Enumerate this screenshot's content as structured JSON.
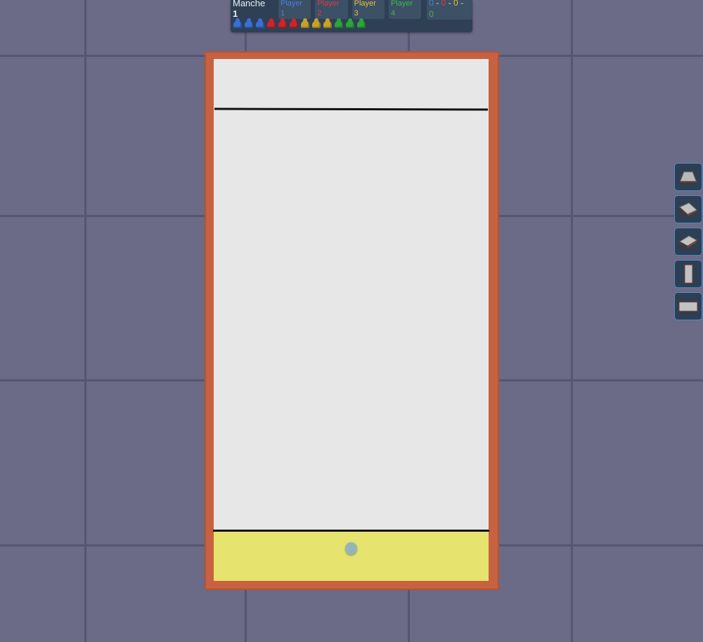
{
  "hud": {
    "round_label": "Manche",
    "round_number": "1",
    "players": [
      {
        "name": "Player 1",
        "color": "#4c7fe0"
      },
      {
        "name": "Player 2",
        "color": "#e0394b"
      },
      {
        "name": "Player 3",
        "color": "#e8c03a"
      },
      {
        "name": "Player 4",
        "color": "#3fb84a"
      }
    ],
    "scores": [
      "0",
      "0",
      "0",
      "0"
    ],
    "score_separator": "-",
    "pawns": [
      {
        "color": "#3a6fd8"
      },
      {
        "color": "#3a6fd8"
      },
      {
        "color": "#3a6fd8"
      },
      {
        "color": "#d0232c"
      },
      {
        "color": "#d0232c"
      },
      {
        "color": "#d0232c"
      },
      {
        "color": "#c9a12a"
      },
      {
        "color": "#c9a12a"
      },
      {
        "color": "#c9a12a"
      },
      {
        "color": "#2aa63a"
      },
      {
        "color": "#2aa63a"
      },
      {
        "color": "#2aa63a"
      }
    ]
  },
  "board": {
    "frame_color": "#c7613f",
    "field_color": "#e7e7e7",
    "home_zone_color": "#e6e36f",
    "ball_color": "#96b3b8"
  },
  "view_buttons": [
    {
      "icon": "perspective-view-icon"
    },
    {
      "icon": "angled-view-left-icon"
    },
    {
      "icon": "angled-view-right-icon"
    },
    {
      "icon": "vertical-view-icon"
    },
    {
      "icon": "horizontal-view-icon"
    }
  ]
}
